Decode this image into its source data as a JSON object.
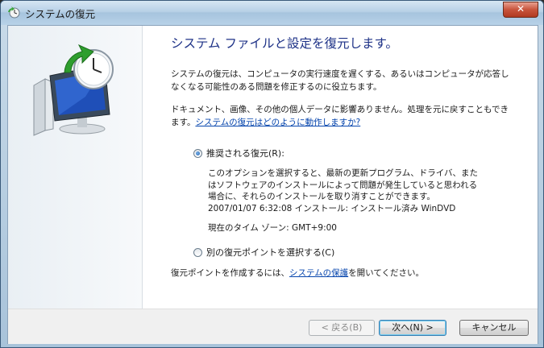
{
  "window": {
    "title": "システムの復元",
    "close_label": "✕"
  },
  "main": {
    "heading": "システム ファイルと設定を復元します。",
    "intro": "システムの復元は、コンピュータの実行速度を遅くする、あるいはコンピュータが応答しなくなる可能性のある問題を修正するのに役立ちます。",
    "note_text": "ドキュメント、画像、その他の個人データに影響ありません。処理を元に戻すこともできます。",
    "note_link": "システムの復元はどのように動作しますか?",
    "options": {
      "recommended": {
        "label": "推奨される復元(R):",
        "checked": true,
        "description": "このオプションを選択すると、最新の更新プログラム、ドライバ、またはソフトウェアのインストールによって問題が発生していると思われる場合に、それらのインストールを取り消すことができます。",
        "restore_point": "2007/01/07 6:32:08 インストール: インストール済み WinDVD",
        "timezone": "現在のタイム ゾーン: GMT+9:00"
      },
      "other": {
        "label": "別の復元ポイントを選択する(C)",
        "checked": false
      }
    },
    "create_text": "復元ポイントを作成するには、",
    "create_link": "システムの保護",
    "create_suffix": "を開いてください。"
  },
  "buttons": {
    "back": "< 戻る(B)",
    "next": "次へ(N) >",
    "cancel": "キャンセル"
  },
  "colors": {
    "heading": "#1e3287",
    "link": "#0645ad",
    "accent": "#1d5fb0"
  },
  "icons": {
    "title": "system-restore-icon",
    "hero": "monitor-clock-restore-icon"
  }
}
